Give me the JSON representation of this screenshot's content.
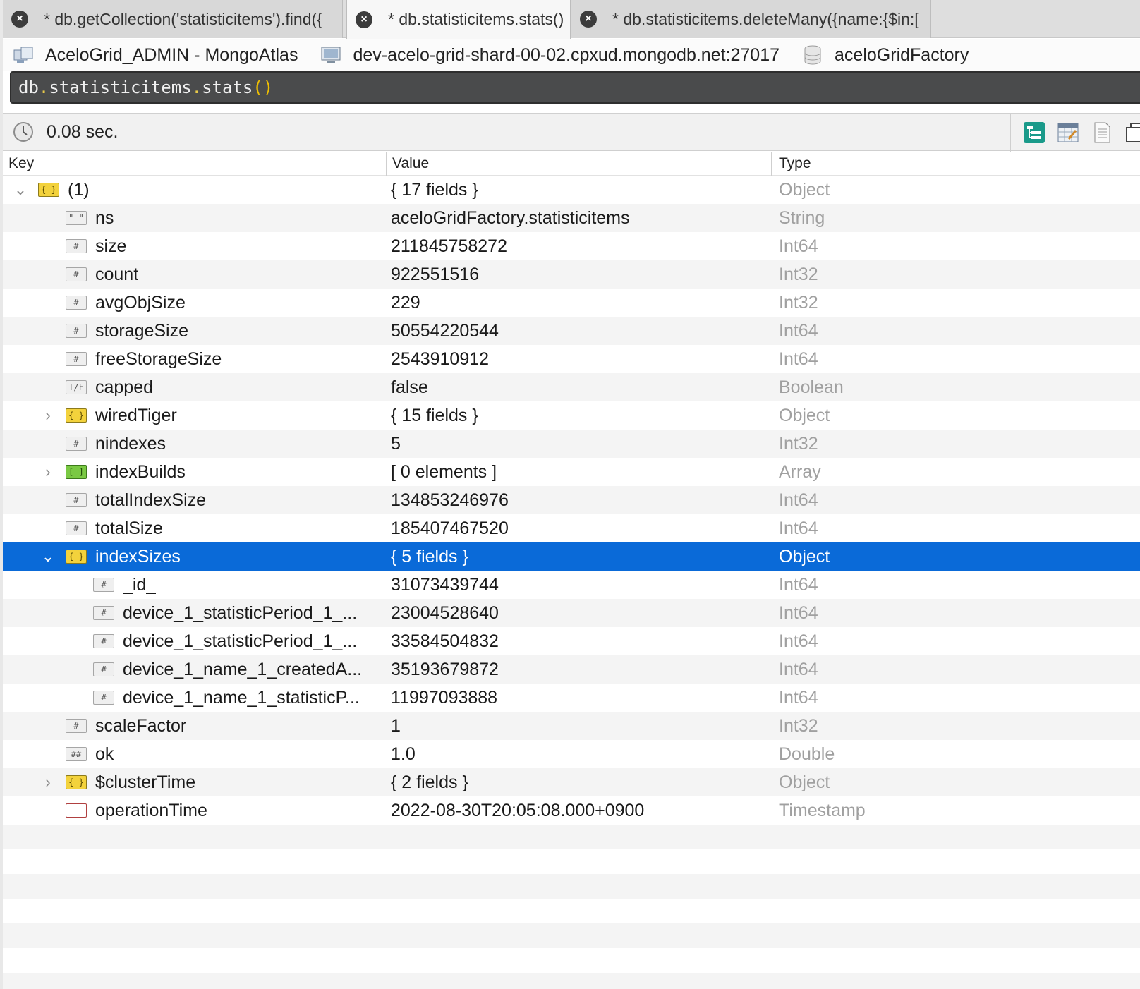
{
  "tabs": [
    {
      "label": "* db.getCollection('statisticitems').find({",
      "active": false
    },
    {
      "label": "* db.statisticitems.stats()",
      "active": true
    },
    {
      "label": "* db.statisticitems.deleteMany({name:{$in:[",
      "active": false
    }
  ],
  "connection": {
    "server": "AceloGrid_ADMIN - MongoAtlas",
    "host": "dev-acelo-grid-shard-00-02.cpxud.mongodb.net:27017",
    "database": "aceloGridFactory"
  },
  "editor": {
    "query_parts": [
      "db",
      ".",
      "statisticitems",
      ".",
      "stats",
      "()"
    ]
  },
  "status": {
    "elapsed": "0.08 sec."
  },
  "columns": {
    "key": "Key",
    "value": "Value",
    "type": "Type"
  },
  "rows": [
    {
      "key": "(1)",
      "value": "{ 17 fields }",
      "type": "Object",
      "icon": "object-icon",
      "depth": 0,
      "expander": "expanded"
    },
    {
      "key": "ns",
      "value": "aceloGridFactory.statisticitems",
      "type": "String",
      "icon": "string-icon",
      "depth": 1,
      "expander": "none"
    },
    {
      "key": "size",
      "value": "211845758272",
      "type": "Int64",
      "icon": "number-icon",
      "depth": 1,
      "expander": "none"
    },
    {
      "key": "count",
      "value": "922551516",
      "type": "Int32",
      "icon": "number-icon",
      "depth": 1,
      "expander": "none"
    },
    {
      "key": "avgObjSize",
      "value": "229",
      "type": "Int32",
      "icon": "number-icon",
      "depth": 1,
      "expander": "none"
    },
    {
      "key": "storageSize",
      "value": "50554220544",
      "type": "Int64",
      "icon": "number-icon",
      "depth": 1,
      "expander": "none"
    },
    {
      "key": "freeStorageSize",
      "value": "2543910912",
      "type": "Int64",
      "icon": "number-icon",
      "depth": 1,
      "expander": "none"
    },
    {
      "key": "capped",
      "value": "false",
      "type": "Boolean",
      "icon": "boolean-icon",
      "depth": 1,
      "expander": "none"
    },
    {
      "key": "wiredTiger",
      "value": "{ 15 fields }",
      "type": "Object",
      "icon": "object-icon",
      "depth": 1,
      "expander": "collapsed"
    },
    {
      "key": "nindexes",
      "value": "5",
      "type": "Int32",
      "icon": "number-icon",
      "depth": 1,
      "expander": "none"
    },
    {
      "key": "indexBuilds",
      "value": "[ 0 elements ]",
      "type": "Array",
      "icon": "array-icon",
      "depth": 1,
      "expander": "collapsed"
    },
    {
      "key": "totalIndexSize",
      "value": "134853246976",
      "type": "Int64",
      "icon": "number-icon",
      "depth": 1,
      "expander": "none"
    },
    {
      "key": "totalSize",
      "value": "185407467520",
      "type": "Int64",
      "icon": "number-icon",
      "depth": 1,
      "expander": "none"
    },
    {
      "key": "indexSizes",
      "value": "{ 5 fields }",
      "type": "Object",
      "icon": "object-icon",
      "depth": 1,
      "expander": "expanded",
      "selected": true
    },
    {
      "key": "_id_",
      "value": "31073439744",
      "type": "Int64",
      "icon": "number-icon",
      "depth": 2,
      "expander": "none"
    },
    {
      "key": "device_1_statisticPeriod_1_...",
      "value": "23004528640",
      "type": "Int64",
      "icon": "number-icon",
      "depth": 2,
      "expander": "none"
    },
    {
      "key": "device_1_statisticPeriod_1_...",
      "value": "33584504832",
      "type": "Int64",
      "icon": "number-icon",
      "depth": 2,
      "expander": "none"
    },
    {
      "key": "device_1_name_1_createdA...",
      "value": "35193679872",
      "type": "Int64",
      "icon": "number-icon",
      "depth": 2,
      "expander": "none"
    },
    {
      "key": "device_1_name_1_statisticP...",
      "value": "11997093888",
      "type": "Int64",
      "icon": "number-icon",
      "depth": 2,
      "expander": "none"
    },
    {
      "key": "scaleFactor",
      "value": "1",
      "type": "Int32",
      "icon": "number-icon",
      "depth": 1,
      "expander": "none"
    },
    {
      "key": "ok",
      "value": "1.0",
      "type": "Double",
      "icon": "double-icon",
      "depth": 1,
      "expander": "none"
    },
    {
      "key": "$clusterTime",
      "value": "{ 2 fields }",
      "type": "Object",
      "icon": "object-icon",
      "depth": 1,
      "expander": "collapsed"
    },
    {
      "key": "operationTime",
      "value": "2022-08-30T20:05:08.000+0900",
      "type": "Timestamp",
      "icon": "timestamp-icon",
      "depth": 1,
      "expander": "none"
    }
  ]
}
